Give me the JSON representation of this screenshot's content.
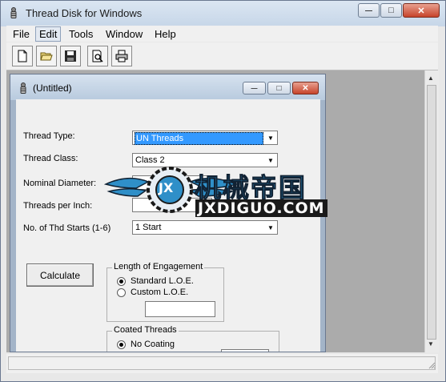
{
  "window": {
    "title": "Thread Disk for Windows",
    "minimize_glyph": "—",
    "maximize_glyph": "□",
    "close_glyph": "✕"
  },
  "menubar": {
    "items": [
      {
        "label": "File"
      },
      {
        "label": "Edit"
      },
      {
        "label": "Tools"
      },
      {
        "label": "Window"
      },
      {
        "label": "Help"
      }
    ]
  },
  "toolbar": {
    "buttons": [
      {
        "icon": "new-document-icon"
      },
      {
        "icon": "open-folder-icon"
      },
      {
        "icon": "save-disk-icon"
      },
      {
        "icon": "print-preview-icon"
      },
      {
        "icon": "printer-icon"
      }
    ]
  },
  "document": {
    "title": "(Untitled)",
    "fields": {
      "thread_type": {
        "label": "Thread Type:",
        "value": "UN Threads"
      },
      "thread_class": {
        "label": "Thread Class:",
        "value": "Class 2"
      },
      "nominal_diameter": {
        "label": "Nominal Diameter:",
        "value": ""
      },
      "threads_per_inch": {
        "label": "Threads per Inch:",
        "value": ""
      },
      "thd_starts": {
        "label": "No. of Thd Starts (1-6)",
        "value": "1 Start"
      }
    },
    "calculate_label": "Calculate",
    "loe_group": {
      "caption": "Length of Engagement",
      "standard_label": "Standard L.O.E.",
      "custom_label": "Custom L.O.E.",
      "custom_value": ""
    },
    "coated_group": {
      "caption": "Coated Threads",
      "no_coating_label": "No Coating"
    }
  },
  "watermark": {
    "logo_text": "JX",
    "chinese_text": "机械帝国",
    "domain_text": "JXDIGUO.COM"
  },
  "colors": {
    "selection": "#3399ff",
    "mdi_background": "#ababab",
    "watermark_blue": "#2f8fc8",
    "watermark_dark": "#1a1a1a"
  }
}
